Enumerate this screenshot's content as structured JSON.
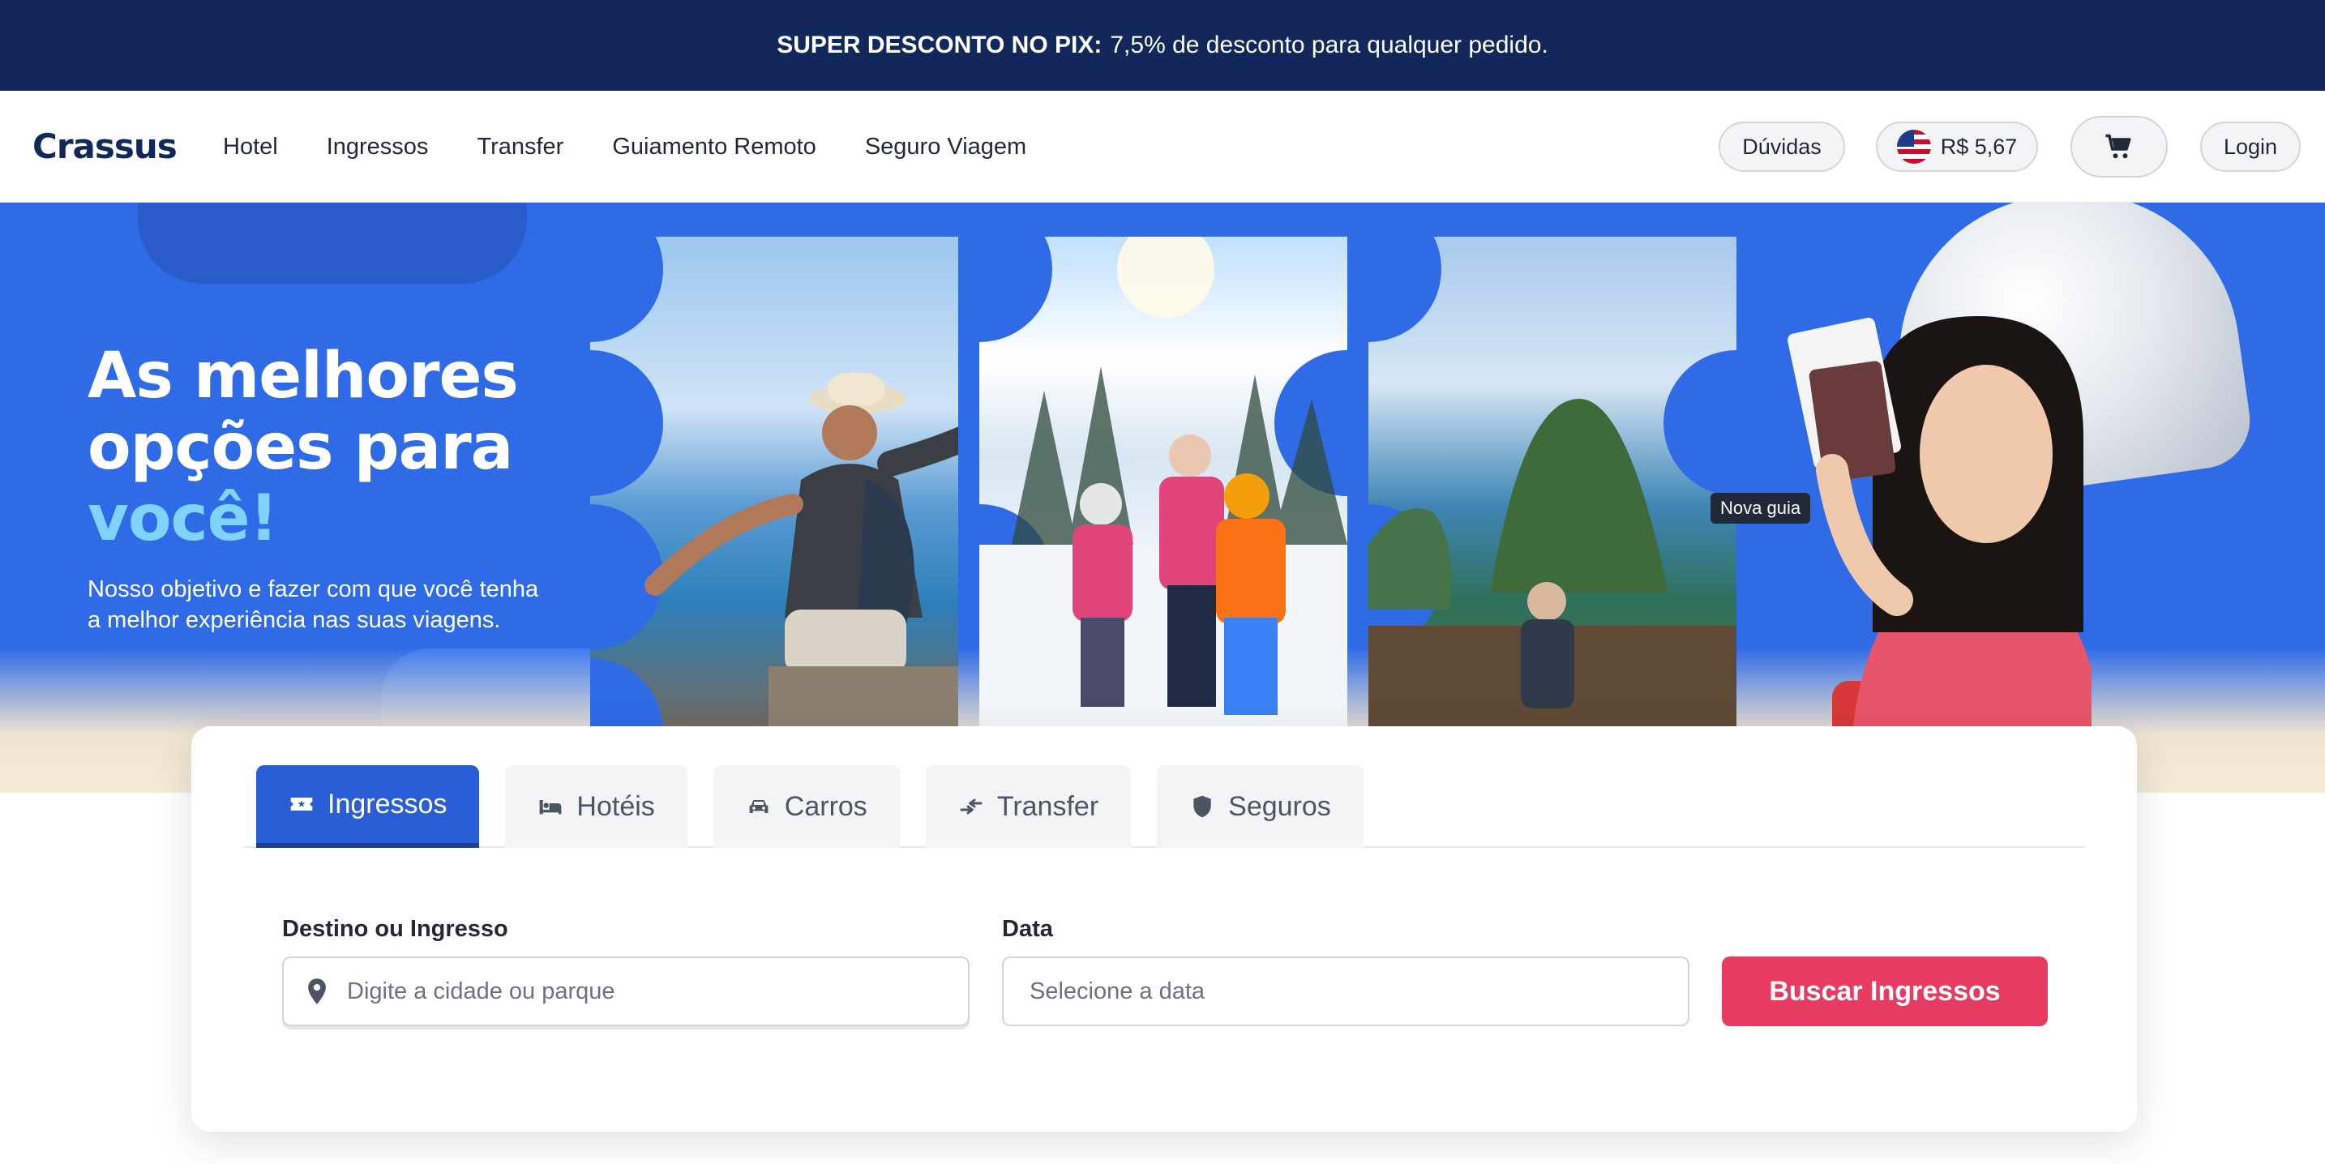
{
  "promo": {
    "bold": "SUPER DESCONTO NO PIX:",
    "text": "7,5% de desconto para qualquer pedido."
  },
  "header": {
    "logo": "Crassus",
    "nav": [
      "Hotel",
      "Ingressos",
      "Transfer",
      "Guiamento Remoto",
      "Seguro Viagem"
    ],
    "faq_label": "Dúvidas",
    "currency_label": "R$ 5,67",
    "login_label": "Login"
  },
  "hero": {
    "title_line1": "As melhores",
    "title_line2": "opções para",
    "title_highlight": "você!",
    "subtitle": "Nosso objetivo e fazer com que você tenha a melhor experiência nas suas viagens.",
    "tooltip": "Nova guia"
  },
  "search": {
    "tabs": [
      {
        "label": "Ingressos",
        "icon": "ticket-icon",
        "active": true
      },
      {
        "label": "Hotéis",
        "icon": "bed-icon",
        "active": false
      },
      {
        "label": "Carros",
        "icon": "car-icon",
        "active": false
      },
      {
        "label": "Transfer",
        "icon": "transfer-icon",
        "active": false
      },
      {
        "label": "Seguros",
        "icon": "shield-icon",
        "active": false
      }
    ],
    "destination_label": "Destino ou Ingresso",
    "destination_placeholder": "Digite a cidade ou parque",
    "date_label": "Data",
    "date_placeholder": "Selecione a data",
    "submit_label": "Buscar Ingressos"
  },
  "colors": {
    "navy": "#13285a",
    "primary": "#2f6be6",
    "accent": "#e63c62",
    "highlight": "#7fd3ff"
  }
}
